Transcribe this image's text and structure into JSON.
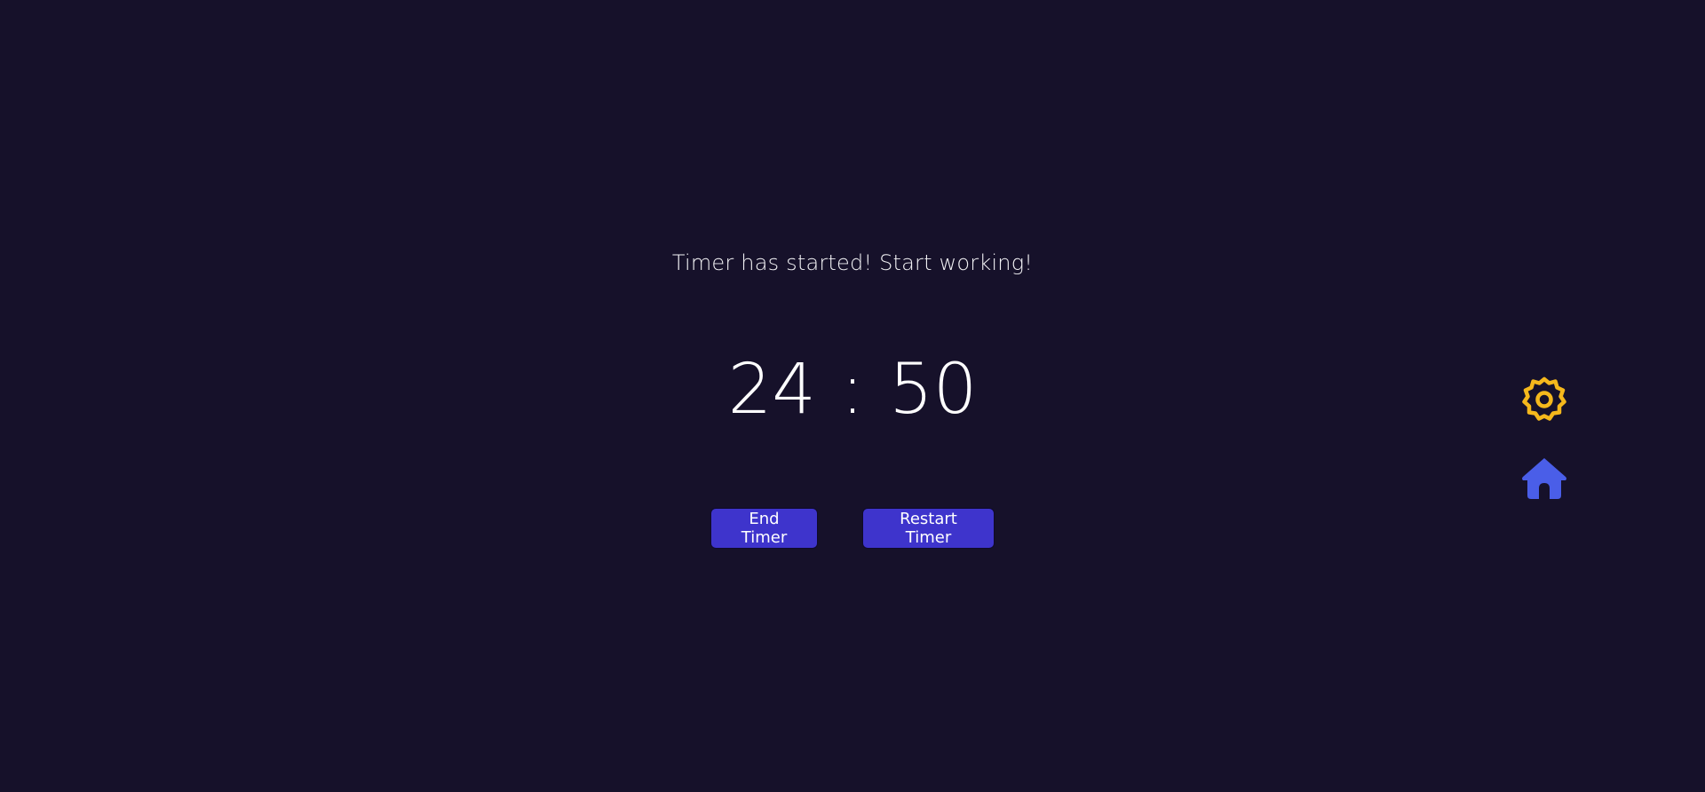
{
  "status": {
    "message": "Timer has started! Start working!"
  },
  "timer": {
    "minutes": "24",
    "separator": ":",
    "seconds": "50"
  },
  "controls": {
    "end_label": "End Timer",
    "restart_label": "Restart Timer"
  },
  "side_nav": {
    "settings_icon": "gear-icon",
    "home_icon": "home-icon"
  },
  "colors": {
    "background": "#16112a",
    "button": "#3e34cc",
    "gear": "#f5b81c",
    "home": "#4a5ee8"
  }
}
